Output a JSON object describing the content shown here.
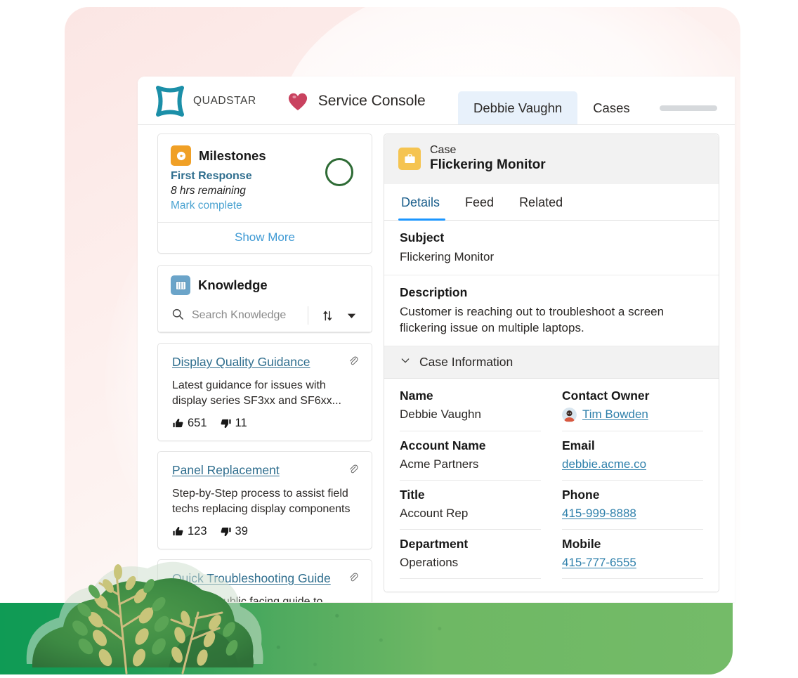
{
  "brand": {
    "name": "QUADSTAR",
    "logo_icon": "quadstar-diamond-icon",
    "accent_color": "#1b8fa8"
  },
  "app": {
    "name": "Service Console",
    "app_icon": "heart-icon",
    "app_icon_color": "#c9425f"
  },
  "tabs": [
    {
      "label": "Debbie Vaughn",
      "active": true
    },
    {
      "label": "Cases",
      "active": false
    }
  ],
  "milestones": {
    "title": "Milestones",
    "icon": "milestone-timer-icon",
    "icon_color": "#f0a026",
    "item_name": "First Response",
    "time_remaining": "8 hrs remaining",
    "action_label": "Mark complete",
    "status_indicator": "empty-circle",
    "status_color": "#2e6b35",
    "show_more_label": "Show More"
  },
  "knowledge": {
    "title": "Knowledge",
    "icon": "book-icon",
    "icon_color": "#6ba4c9",
    "search_placeholder": "Search Knowledge",
    "search_value": "",
    "sort_icon": "sort-arrows-icon",
    "filter_icon": "chevron-down-icon",
    "articles": [
      {
        "title": "Display Quality Guidance",
        "description": "Latest guidance for issues with display series SF3xx and SF6xx...",
        "up_votes": "651",
        "down_votes": "11",
        "attach_icon": "paperclip-icon"
      },
      {
        "title": "Panel Replacement",
        "description": "Step-by-Step process to assist field techs replacing display components",
        "up_votes": "123",
        "down_votes": "39",
        "attach_icon": "paperclip-icon"
      },
      {
        "title": "Quick Troubleshooting Guide",
        "description": "This is a public facing guide to",
        "up_votes": "",
        "down_votes": "",
        "attach_icon": "paperclip-icon"
      }
    ]
  },
  "case": {
    "record_type": "Case",
    "record_name": "Flickering Monitor",
    "icon": "case-briefcase-icon",
    "icon_color": "#f5c451",
    "tabs": [
      {
        "label": "Details",
        "active": true
      },
      {
        "label": "Feed",
        "active": false
      },
      {
        "label": "Related",
        "active": false
      }
    ],
    "subject_label": "Subject",
    "subject_value": "Flickering Monitor",
    "description_label": "Description",
    "description_value": "Customer is reaching out to troubleshoot a screen flickering issue on multiple laptops.",
    "section_title": "Case Information",
    "section_toggle_icon": "chevron-down-icon",
    "fields": [
      {
        "label": "Name",
        "value": "Debbie Vaughn",
        "type": "text"
      },
      {
        "label": "Contact Owner",
        "value": "Tim Bowden",
        "type": "link-avatar"
      },
      {
        "label": "Account Name",
        "value": "Acme Partners",
        "type": "text"
      },
      {
        "label": "Email",
        "value": "debbie.acme.co",
        "type": "link"
      },
      {
        "label": "Title",
        "value": "Account Rep",
        "type": "text"
      },
      {
        "label": "Phone",
        "value": "415-999-8888",
        "type": "link"
      },
      {
        "label": "Department",
        "value": "Operations",
        "type": "text"
      },
      {
        "label": "Mobile",
        "value": "415-777-6555",
        "type": "link"
      }
    ]
  }
}
